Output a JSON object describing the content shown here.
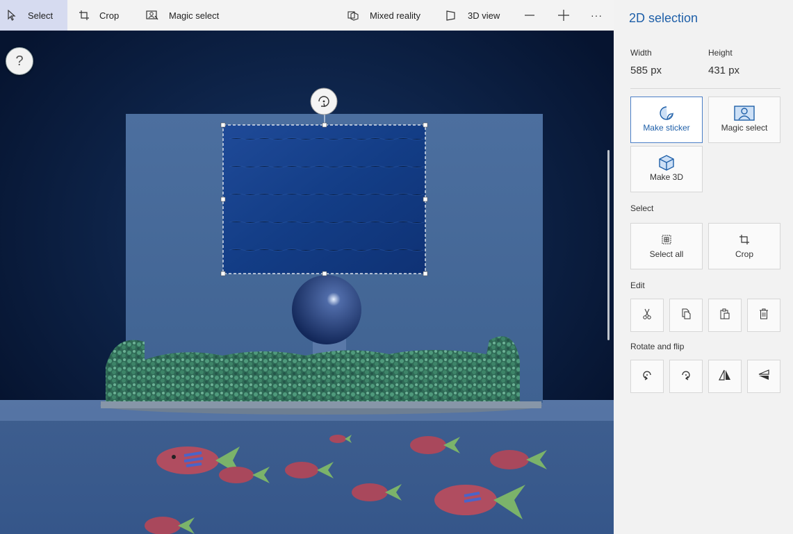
{
  "toolbar": {
    "select_label": "Select",
    "crop_label": "Crop",
    "magic_select_label": "Magic select",
    "mixed_reality_label": "Mixed reality",
    "view_3d_label": "3D view",
    "more_label": "···"
  },
  "help": {
    "label": "?"
  },
  "panel": {
    "title": "2D selection",
    "width_label": "Width",
    "width_value": "585 px",
    "height_label": "Height",
    "height_value": "431 px",
    "make_sticker": "Make sticker",
    "magic_select": "Magic select",
    "make_3d": "Make 3D",
    "select_section": "Select",
    "select_all": "Select all",
    "crop": "Crop",
    "edit_section": "Edit",
    "rotate_section": "Rotate and flip"
  },
  "colors": {
    "accent": "#1e5fa8",
    "panel_bg": "#f2f2f2",
    "selected_tool_bg": "#d6dbf0"
  }
}
